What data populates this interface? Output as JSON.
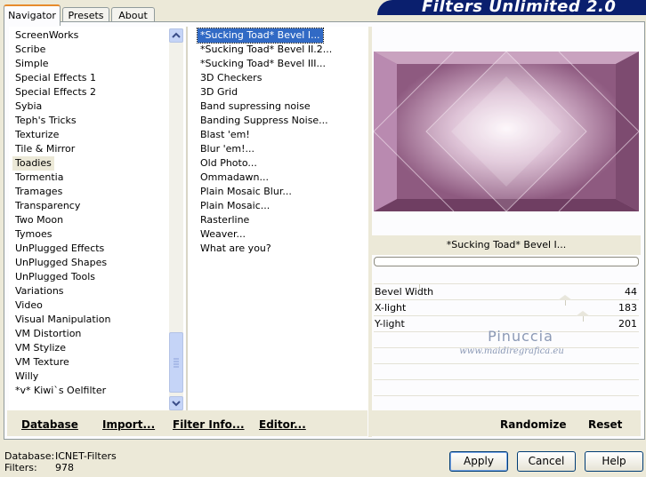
{
  "banner": "Filters Unlimited 2.0",
  "tabs": [
    "Navigator",
    "Presets",
    "About"
  ],
  "categories": [
    "ScreenWorks",
    "Scribe",
    "Simple",
    "Special Effects 1",
    "Special Effects 2",
    "Sybia",
    "Teph's Tricks",
    "Texturize",
    "Tile & Mirror",
    "Toadies",
    "Tormentia",
    "Tramages",
    "Transparency",
    "Two Moon",
    "Tymoes",
    "UnPlugged Effects",
    "UnPlugged Shapes",
    "UnPlugged Tools",
    "Variations",
    "Video",
    "Visual Manipulation",
    "VM Distortion",
    "VM Stylize",
    "VM Texture",
    "Willy",
    "*v* Kiwi`s Oelfilter"
  ],
  "selected_category": "Toadies",
  "filters": [
    "*Sucking Toad*  Bevel I...",
    "*Sucking Toad*  Bevel II.2...",
    "*Sucking Toad*  Bevel III...",
    "3D Checkers",
    "3D Grid",
    "Band supressing noise",
    "Banding Suppress Noise...",
    "Blast 'em!",
    "Blur 'em!...",
    "Old Photo...",
    "Ommadawn...",
    "Plain Mosaic Blur...",
    "Plain Mosaic...",
    "Rasterline",
    "Weaver...",
    "What are you?"
  ],
  "selected_filter": "*Sucking Toad*  Bevel I...",
  "preview_title": "*Sucking Toad*  Bevel I...",
  "params": [
    {
      "name": "Bevel Width",
      "value": "44",
      "level": 0.17
    },
    {
      "name": "X-light",
      "value": "183",
      "level": 0.72
    },
    {
      "name": "Y-light",
      "value": "201",
      "level": 0.79
    }
  ],
  "watermark": {
    "name": "Pinuccia",
    "site": "www.maidiregrafica.eu"
  },
  "left_buttons": {
    "database": "Database",
    "import": "Import...",
    "filter_info": "Filter Info...",
    "editor": "Editor..."
  },
  "right_buttons": {
    "randomize": "Randomize",
    "reset": "Reset"
  },
  "status": {
    "database_label": "Database:",
    "database_value": "ICNET-Filters",
    "filters_label": "Filters:",
    "filters_value": "978"
  },
  "dialog": {
    "apply": "Apply",
    "cancel": "Cancel",
    "help": "Help"
  },
  "colors": {
    "selection": "#316ac5",
    "banner": "#0a1f6e",
    "preview": "#b58aaa"
  }
}
